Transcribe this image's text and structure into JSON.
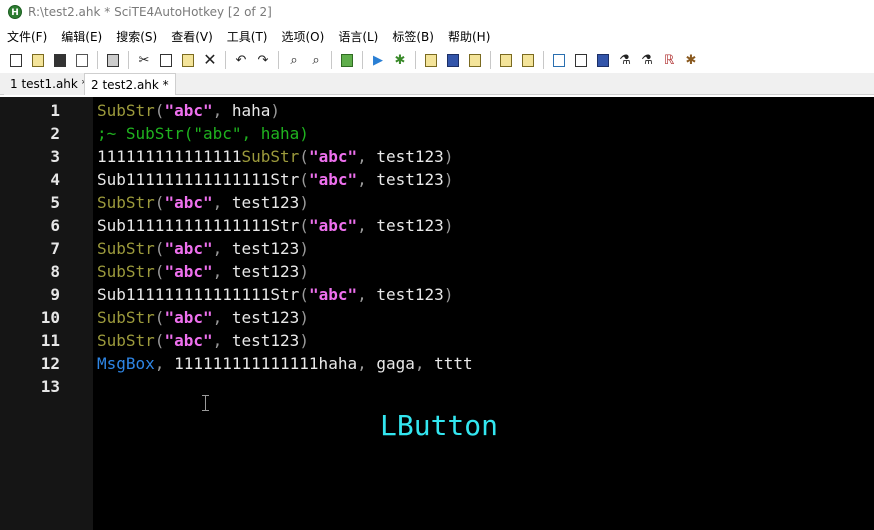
{
  "window": {
    "title": "R:\\test2.ahk * SciTE4AutoHotkey [2 of 2]",
    "app_icon_letter": "H"
  },
  "menubar": {
    "items": [
      {
        "label": "文件(F)"
      },
      {
        "label": "编辑(E)"
      },
      {
        "label": "搜索(S)"
      },
      {
        "label": "查看(V)"
      },
      {
        "label": "工具(T)"
      },
      {
        "label": "选项(O)"
      },
      {
        "label": "语言(L)"
      },
      {
        "label": "标签(B)"
      },
      {
        "label": "帮助(H)"
      }
    ]
  },
  "toolbar": {
    "icons": [
      "new-file-icon",
      "open-folder-icon",
      "save-icon",
      "close-file-icon",
      "print-icon",
      "cut-icon",
      "copy-icon",
      "paste-icon",
      "delete-icon",
      "undo-icon",
      "redo-icon",
      "find-icon",
      "replace-icon",
      "compile-icon",
      "run-icon",
      "debug-icon",
      "script-icon-1",
      "script-icon-2",
      "script-icon-3",
      "tool-icon-1",
      "tool-icon-2",
      "tool-icon-3",
      "tool-icon-4",
      "tool-icon-5",
      "tool-icon-6",
      "tool-icon-7",
      "tool-icon-8",
      "tool-icon-9"
    ]
  },
  "tabs": [
    {
      "label": "1 test1.ahk *",
      "active": false
    },
    {
      "label": "2 test2.ahk *",
      "active": true
    }
  ],
  "editor": {
    "line_numbers": [
      "1",
      "2",
      "3",
      "4",
      "5",
      "6",
      "7",
      "8",
      "9",
      "10",
      "11",
      "12",
      "13"
    ],
    "lines": [
      [
        {
          "t": "fn",
          "v": "SubStr"
        },
        {
          "t": "punc",
          "v": "("
        },
        {
          "t": "str",
          "v": "\"abc\""
        },
        {
          "t": "punc",
          "v": ", "
        },
        {
          "t": "var",
          "v": "haha"
        },
        {
          "t": "punc",
          "v": ")"
        }
      ],
      [
        {
          "t": "cmt",
          "v": ";~ SubStr(\"abc\", haha)"
        }
      ],
      [
        {
          "t": "var",
          "v": "111111111111111"
        },
        {
          "t": "fn",
          "v": "SubStr"
        },
        {
          "t": "punc",
          "v": "("
        },
        {
          "t": "str",
          "v": "\"abc\""
        },
        {
          "t": "punc",
          "v": ", "
        },
        {
          "t": "var",
          "v": "test123"
        },
        {
          "t": "punc",
          "v": ")"
        }
      ],
      [
        {
          "t": "var",
          "v": "Sub111111111111111Str"
        },
        {
          "t": "punc",
          "v": "("
        },
        {
          "t": "str",
          "v": "\"abc\""
        },
        {
          "t": "punc",
          "v": ", "
        },
        {
          "t": "var",
          "v": "test123"
        },
        {
          "t": "punc",
          "v": ")"
        }
      ],
      [
        {
          "t": "fn",
          "v": "SubStr"
        },
        {
          "t": "punc",
          "v": "("
        },
        {
          "t": "str",
          "v": "\"abc\""
        },
        {
          "t": "punc",
          "v": ", "
        },
        {
          "t": "var",
          "v": "test123"
        },
        {
          "t": "punc",
          "v": ")"
        }
      ],
      [
        {
          "t": "var",
          "v": "Sub111111111111111Str"
        },
        {
          "t": "punc",
          "v": "("
        },
        {
          "t": "str",
          "v": "\"abc\""
        },
        {
          "t": "punc",
          "v": ", "
        },
        {
          "t": "var",
          "v": "test123"
        },
        {
          "t": "punc",
          "v": ")"
        }
      ],
      [
        {
          "t": "fn",
          "v": "SubStr"
        },
        {
          "t": "punc",
          "v": "("
        },
        {
          "t": "str",
          "v": "\"abc\""
        },
        {
          "t": "punc",
          "v": ", "
        },
        {
          "t": "var",
          "v": "test123"
        },
        {
          "t": "punc",
          "v": ")"
        }
      ],
      [
        {
          "t": "fn",
          "v": "SubStr"
        },
        {
          "t": "punc",
          "v": "("
        },
        {
          "t": "str",
          "v": "\"abc\""
        },
        {
          "t": "punc",
          "v": ", "
        },
        {
          "t": "var",
          "v": "test123"
        },
        {
          "t": "punc",
          "v": ")"
        }
      ],
      [
        {
          "t": "var",
          "v": "Sub111111111111111Str"
        },
        {
          "t": "punc",
          "v": "("
        },
        {
          "t": "str",
          "v": "\"abc\""
        },
        {
          "t": "punc",
          "v": ", "
        },
        {
          "t": "var",
          "v": "test123"
        },
        {
          "t": "punc",
          "v": ")"
        }
      ],
      [
        {
          "t": "fn",
          "v": "SubStr"
        },
        {
          "t": "punc",
          "v": "("
        },
        {
          "t": "str",
          "v": "\"abc\""
        },
        {
          "t": "punc",
          "v": ", "
        },
        {
          "t": "var",
          "v": "test123"
        },
        {
          "t": "punc",
          "v": ")"
        }
      ],
      [
        {
          "t": "fn",
          "v": "SubStr"
        },
        {
          "t": "punc",
          "v": "("
        },
        {
          "t": "str",
          "v": "\"abc\""
        },
        {
          "t": "punc",
          "v": ", "
        },
        {
          "t": "var",
          "v": "test123"
        },
        {
          "t": "punc",
          "v": ")"
        }
      ],
      [
        {
          "t": "cmd",
          "v": "MsgBox"
        },
        {
          "t": "punc",
          "v": ", "
        },
        {
          "t": "var",
          "v": "111111111111111haha"
        },
        {
          "t": "punc",
          "v": ", "
        },
        {
          "t": "var",
          "v": "gaga"
        },
        {
          "t": "punc",
          "v": ", "
        },
        {
          "t": "var",
          "v": "tttt"
        }
      ],
      []
    ],
    "overlay_text": "LButton",
    "colors": {
      "background": "#000000",
      "gutter": "#151515",
      "function": "#9c9a3c",
      "string": "#ee70ee",
      "comment": "#1fb31f",
      "command": "#2e86e6",
      "overlay": "#33e6f0"
    }
  }
}
